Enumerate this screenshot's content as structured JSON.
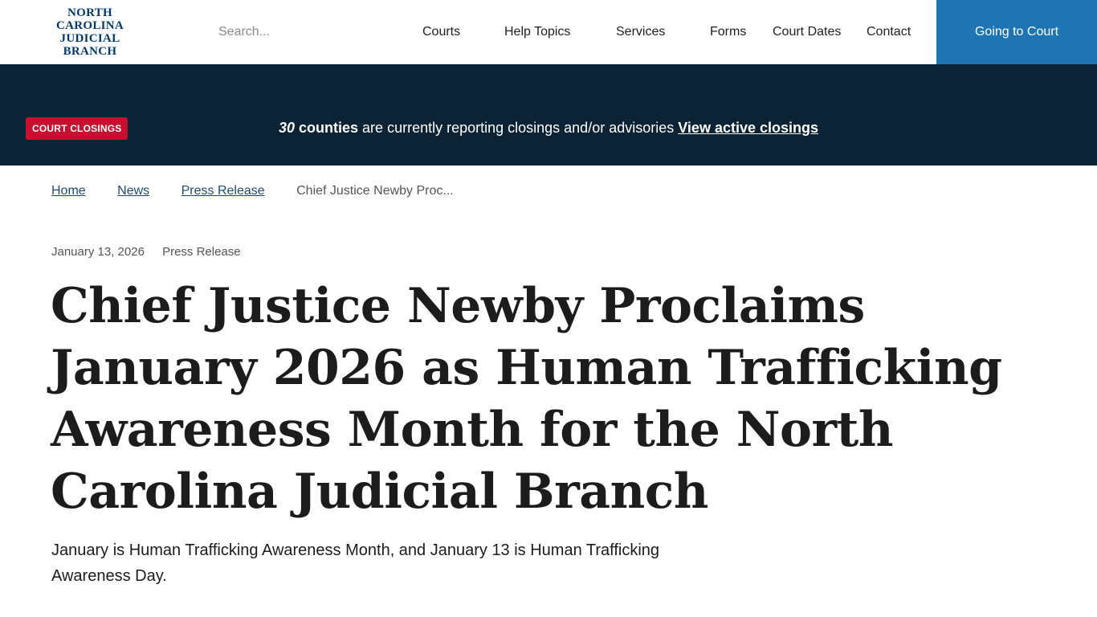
{
  "header": {
    "logo_lines": [
      "NORTH",
      "CAROLINA",
      "JUDICIAL",
      "BRANCH"
    ],
    "search_placeholder": "Search...",
    "nav": [
      "Courts",
      "Help Topics",
      "Services",
      "Forms",
      "Court Dates",
      "Contact"
    ],
    "cta_label": "Going to Court"
  },
  "banner": {
    "badge": "COURT CLOSINGS",
    "count": "30",
    "counties": "counties",
    "message": "are currently reporting closings and/or advisories",
    "link": "View active closings"
  },
  "breadcrumb": {
    "links": [
      "Home",
      "News",
      "Press Release"
    ],
    "current": "Chief Justice Newby Proc..."
  },
  "article": {
    "date": "January 13, 2026",
    "category": "Press Release",
    "title": "Chief Justice Newby Proclaims January 2026 as Human Trafficking Awareness Month for the North Carolina Judicial Branch",
    "summary": "January is Human Trafficking Awareness Month, and January 13 is Human Trafficking Awareness Day."
  },
  "colors": {
    "brand_navy": "#003a70",
    "cta_blue": "#1f75b3",
    "banner_bg": "#0b2335",
    "badge_red": "#c8102e"
  }
}
